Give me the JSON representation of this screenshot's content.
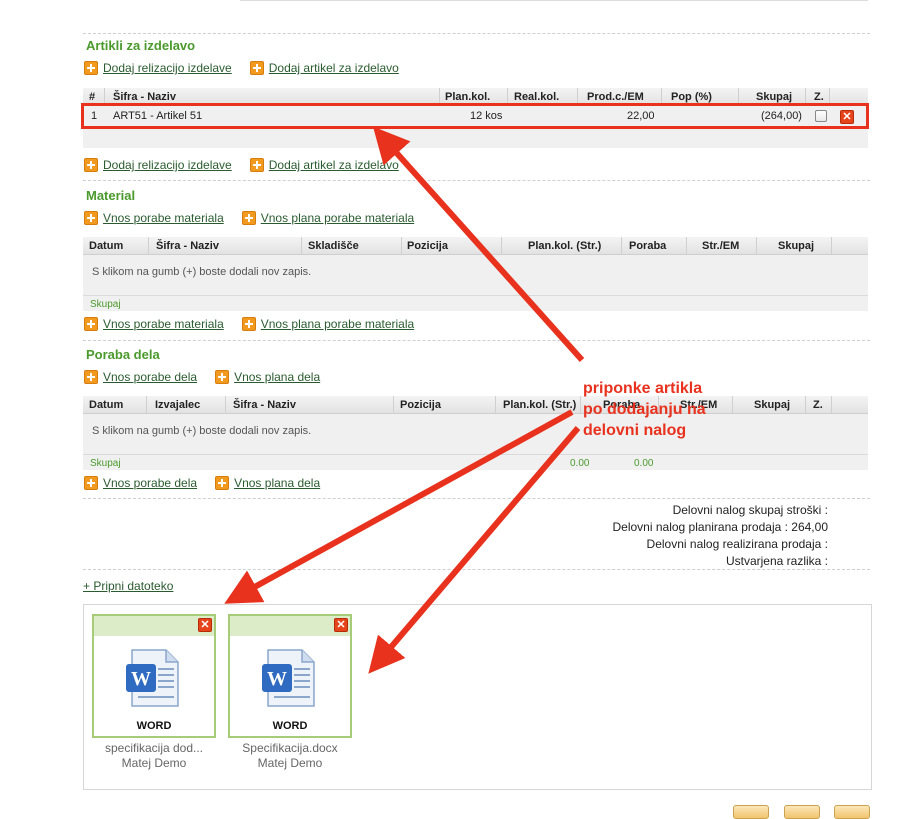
{
  "articles": {
    "title": "Artikli za izdelavo",
    "link_add_realization": "Dodaj relizacijo izdelave",
    "link_add_article": "Dodaj artikel za izdelavo",
    "headers": [
      "#",
      "Šifra - Naziv",
      "Plan.kol.",
      "Real.kol.",
      "Prod.c./EM",
      "Pop (%)",
      "Skupaj",
      "Z."
    ],
    "rows": [
      {
        "num": "1",
        "name": "ART51 - Artikel 51",
        "plan_qty": "12 kos",
        "real_qty": "",
        "price": "22,00",
        "discount": "",
        "total": "(264,00)"
      }
    ]
  },
  "material": {
    "title": "Material",
    "link_usage": "Vnos porabe materiala",
    "link_plan": "Vnos plana porabe materiala",
    "headers": [
      "Datum",
      "Šifra - Naziv",
      "Skladišče",
      "Pozicija",
      "Plan.kol. (Str.)",
      "Poraba",
      "Str./EM",
      "Skupaj"
    ],
    "empty_message": "S klikom na gumb (+) boste dodali nov zapis.",
    "sum_label": "Skupaj"
  },
  "labor": {
    "title": "Poraba dela",
    "link_usage": "Vnos porabe dela",
    "link_plan": "Vnos plana dela",
    "headers": [
      "Datum",
      "Izvajalec",
      "Šifra - Naziv",
      "Pozicija",
      "Plan.kol. (Str.)",
      "Poraba",
      "Str./EM",
      "Skupaj",
      "Z."
    ],
    "empty_message": "S klikom na gumb (+) boste dodali nov zapis.",
    "sum_label": "Skupaj",
    "sum_plan": "0.00",
    "sum_usage": "0.00"
  },
  "summary": {
    "line1": "Delovni nalog skupaj stroški :",
    "line2": "Delovni nalog planirana prodaja : 264,00",
    "line3": "Delovni nalog realizirana prodaja :",
    "line4": "Ustvarjena razlika :"
  },
  "attach_link": "+ Pripni datoteko",
  "attachments": [
    {
      "type_label": "WORD",
      "filename": "specifikacija dod...",
      "owner": "Matej Demo"
    },
    {
      "type_label": "WORD",
      "filename": "Specifikacija.docx",
      "owner": "Matej Demo"
    }
  ],
  "annotation": {
    "line1": "priponke artikla",
    "line2": "po dodajanju na",
    "line3": "delovni nalog"
  },
  "colors": {
    "accent_green": "#4a9a2c",
    "annotation_red": "#e8321e",
    "add_orange": "#f29a1f"
  }
}
